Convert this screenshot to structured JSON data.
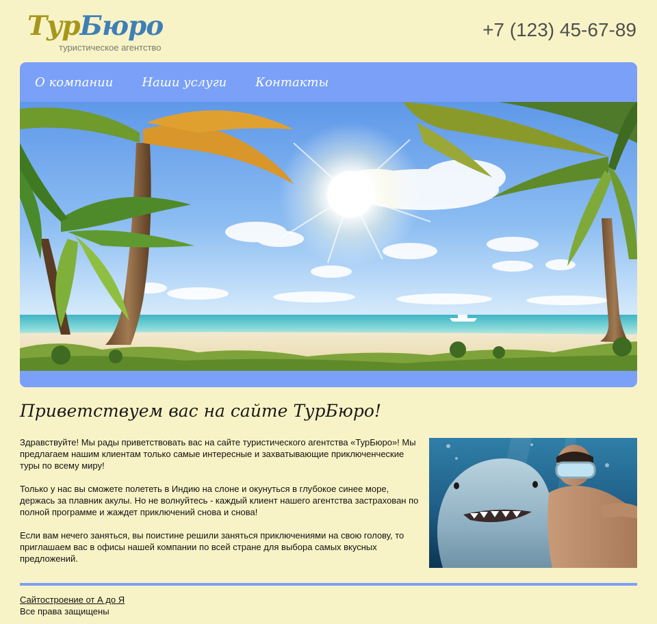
{
  "header": {
    "logo_part1": "Тур",
    "logo_part2": "Бюро",
    "logo_subtitle": "туристическое агентство",
    "phone": "+7 (123) 45-67-89"
  },
  "nav": {
    "items": [
      {
        "label": "О компании"
      },
      {
        "label": "Наши услуги"
      },
      {
        "label": "Контакты"
      }
    ]
  },
  "hero": {
    "image": "tropical-beach-palms-banner"
  },
  "main": {
    "title": "Приветствуем вас на сайте ТурБюро!",
    "paragraphs": [
      "Здравствуйте! Мы рады приветствовать вас на сайте туристического агентства «ТурБюро»! Мы предлагаем нашим клиентам только самые интересные и захватывающие приключен­ческие туры по всему миру!",
      "Только у нас вы сможете полететь в Индию на слоне и окунуться в глубокое синее море, держась за плавник акулы. Но не волнуйтесь - каждый клиент нашего агентства застрахо­ван по полной программе и жаждет приключений снова и снова!",
      "Если вам нечего заняться, вы поистине решили заняться приключениями на свою голову, то приглашаем вас в офисы нашей компании по всей стране для выбора самых вкусных предложений."
    ],
    "photo": "diver-with-shark-photo"
  },
  "footer": {
    "link": "Сайтостроение от А до Я",
    "rights": "Все права защищены"
  },
  "colors": {
    "background": "#f8f3c6",
    "accent_blue": "#7aa0f7",
    "logo_olive": "#a6961c",
    "logo_blue": "#3f7fb6"
  }
}
